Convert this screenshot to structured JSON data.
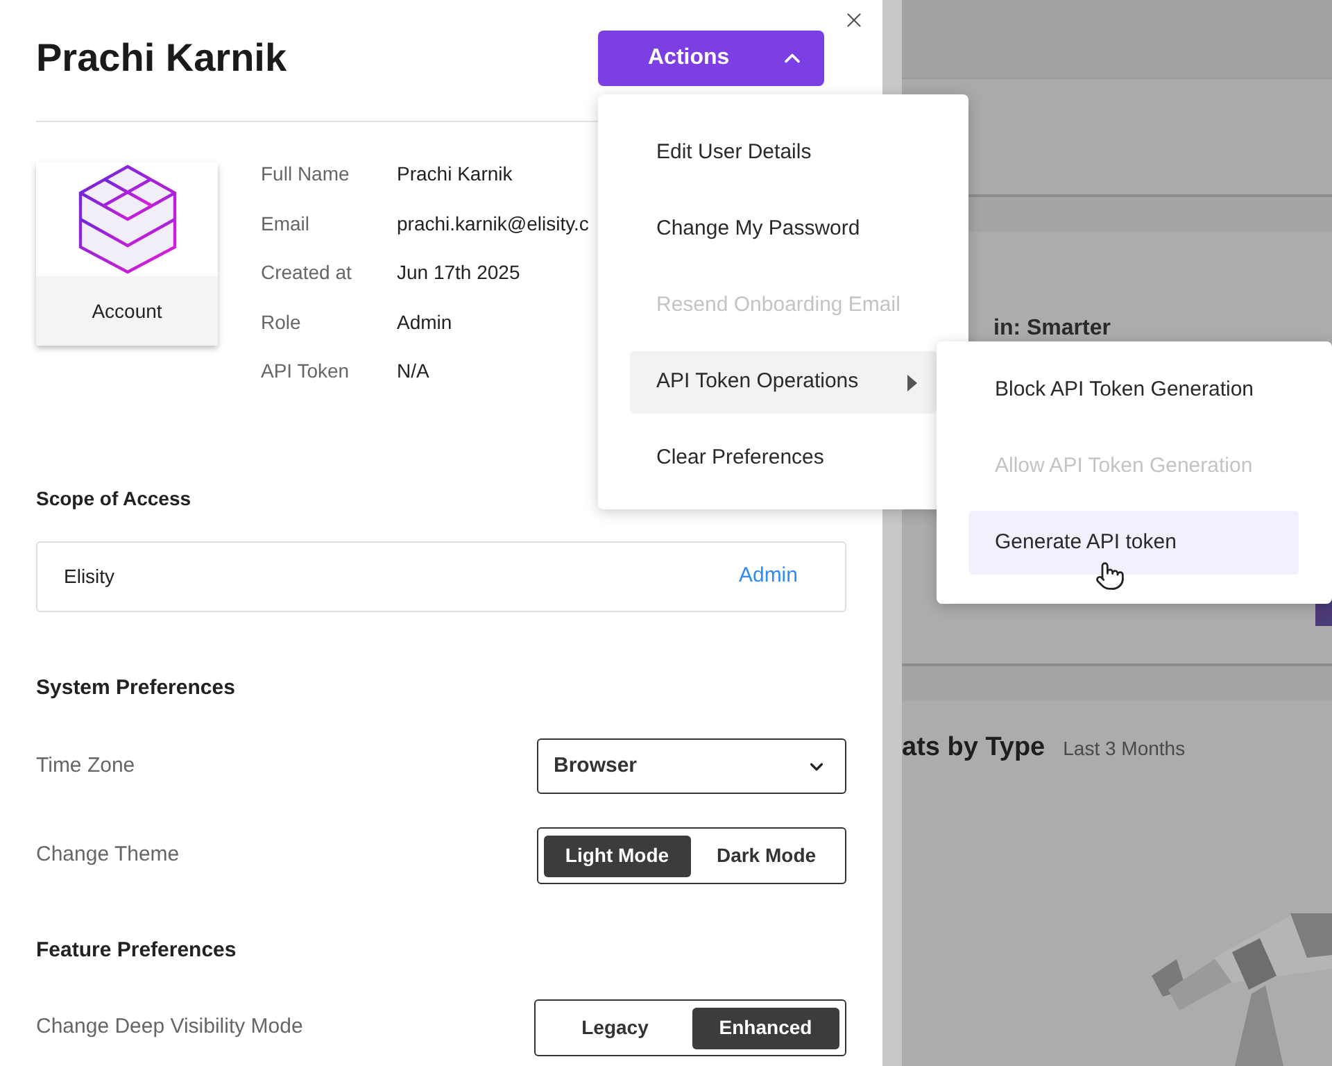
{
  "profile": {
    "name": "Prachi Karnik",
    "avatar_label": "Account",
    "fields": [
      {
        "label": "Full Name",
        "value": "Prachi Karnik"
      },
      {
        "label": "Email",
        "value": "prachi.karnik@elisity.c"
      },
      {
        "label": "Created at",
        "value": "Jun 17th 2025"
      },
      {
        "label": "Role",
        "value": "Admin"
      },
      {
        "label": "API Token",
        "value": "N/A"
      }
    ]
  },
  "actions_button": {
    "label": "Actions",
    "expanded": true
  },
  "actions_menu": [
    {
      "label": "Edit User Details",
      "kind": "item",
      "disabled": false,
      "selected": false
    },
    {
      "label": "Change My Password",
      "kind": "item",
      "disabled": false,
      "selected": false
    },
    {
      "label": "Resend Onboarding Email",
      "kind": "item",
      "disabled": true,
      "selected": false
    },
    {
      "label": "API Token Operations",
      "kind": "submenu",
      "disabled": false,
      "selected": true
    },
    {
      "label": "Clear Preferences",
      "kind": "item",
      "disabled": false,
      "selected": false
    }
  ],
  "submenu": [
    {
      "label": "Block API Token Generation",
      "disabled": false,
      "selected": false
    },
    {
      "label": "Allow API Token Generation",
      "disabled": true,
      "selected": false
    },
    {
      "label": "Generate API token",
      "disabled": false,
      "selected": true
    }
  ],
  "scope_of_access": {
    "title": "Scope of Access",
    "rows": [
      {
        "name": "Elisity",
        "role": "Admin"
      }
    ]
  },
  "system_preferences": {
    "title": "System Preferences",
    "time_zone": {
      "label": "Time Zone",
      "value": "Browser"
    },
    "theme": {
      "label": "Change Theme",
      "options": [
        {
          "label": "Light Mode",
          "selected": true
        },
        {
          "label": "Dark Mode",
          "selected": false
        }
      ]
    }
  },
  "feature_preferences": {
    "title": "Feature Preferences",
    "deep_visibility": {
      "label": "Change Deep Visibility Mode",
      "options": [
        {
          "label": "Legacy",
          "selected": false
        },
        {
          "label": "Enhanced",
          "selected": true
        }
      ]
    }
  },
  "background": {
    "banner_text": "in: Smarter",
    "card_title": "ats by Type",
    "card_subtitle": "Last 3 Months"
  }
}
